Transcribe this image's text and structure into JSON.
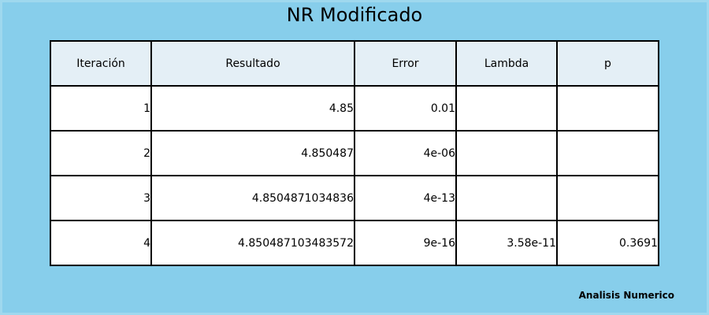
{
  "title": "NR Modificado",
  "footer": "Analisis Numerico",
  "chart_data": {
    "type": "table",
    "title": "NR Modificado",
    "columns": [
      "Iteración",
      "Resultado",
      "Error",
      "Lambda",
      "p"
    ],
    "rows": [
      [
        "1",
        "4.85",
        "0.01",
        "",
        ""
      ],
      [
        "2",
        "4.850487",
        "4e-06",
        "",
        ""
      ],
      [
        "3",
        "4.8504871034836",
        "4e-13",
        "",
        ""
      ],
      [
        "4",
        "4.850487103483572",
        "9e-16",
        "3.58e-11",
        "0.3691"
      ]
    ],
    "colors": {
      "background": "#87CEEB",
      "header": "#E4EFF6",
      "cell": "#FFFFFF"
    }
  }
}
